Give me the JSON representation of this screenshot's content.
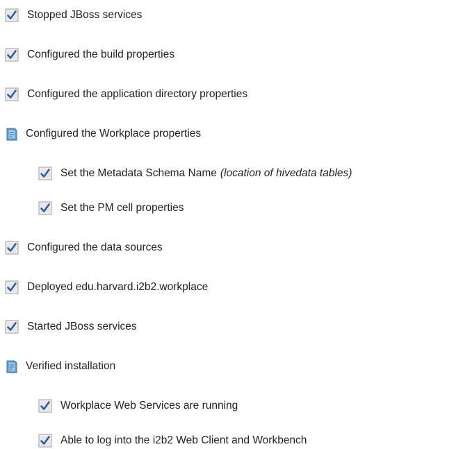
{
  "colors": {
    "check_box_fill": "#e7e7e7",
    "check_box_border": "#9a9a9a",
    "check_mark": "#2f5fa0",
    "doc_icon_fill": "#6da8d8",
    "doc_icon_border": "#3a6f9f",
    "text": "#222222"
  },
  "items": [
    {
      "icon": "checkmark-icon",
      "label": "Stopped JBoss services"
    },
    {
      "icon": "checkmark-icon",
      "label": "Configured the build properties"
    },
    {
      "icon": "checkmark-icon",
      "label": "Configured the application directory properties"
    },
    {
      "icon": "document-icon",
      "label": "Configured the Workplace properties"
    },
    {
      "icon": "checkmark-icon",
      "label": "Set the Metadata Schema Name",
      "note": "(location of hivedata tables)"
    },
    {
      "icon": "checkmark-icon",
      "label": "Set the PM cell properties"
    },
    {
      "icon": "checkmark-icon",
      "label": "Configured the data sources"
    },
    {
      "icon": "checkmark-icon",
      "label": "Deployed edu.harvard.i2b2.workplace"
    },
    {
      "icon": "checkmark-icon",
      "label": "Started JBoss services"
    },
    {
      "icon": "document-icon",
      "label": "Verified installation"
    },
    {
      "icon": "checkmark-icon",
      "label": "Workplace Web Services are running"
    },
    {
      "icon": "checkmark-icon",
      "label": "Able to log into the i2b2 Web Client and Workbench"
    }
  ]
}
